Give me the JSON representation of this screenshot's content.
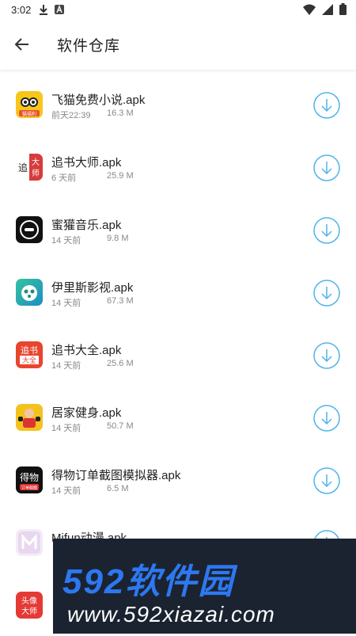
{
  "status": {
    "time": "3:02",
    "download_icon": "download-icon",
    "a_icon": "a-icon",
    "wifi_icon": "wifi-icon",
    "signal_icon": "signal-icon",
    "battery_icon": "battery-icon"
  },
  "header": {
    "title": "软件仓库",
    "back_icon": "arrow-back-icon"
  },
  "apps": [
    {
      "name": "飞猫免费小说.apk",
      "time": "前天22:39",
      "size": "16.3 M",
      "icon": "feimao-icon",
      "color": "#f7c61b"
    },
    {
      "name": "追书大师.apk",
      "time": "6 天前",
      "size": "25.9 M",
      "icon": "zhuishu-dashi-icon",
      "color": "#d83b3b"
    },
    {
      "name": "蜜獾音乐.apk",
      "time": "14 天前",
      "size": "9.8 M",
      "icon": "mihuan-music-icon",
      "color": "#111111"
    },
    {
      "name": "伊里斯影视.apk",
      "time": "14 天前",
      "size": "67.3 M",
      "icon": "yilisi-icon",
      "color": "#2bb38d"
    },
    {
      "name": "追书大全.apk",
      "time": "14 天前",
      "size": "25.6 M",
      "icon": "zhuishu-daquan-icon",
      "color": "#e8442e"
    },
    {
      "name": "居家健身.apk",
      "time": "14 天前",
      "size": "50.7 M",
      "icon": "jujia-fitness-icon",
      "color": "#f4c21f"
    },
    {
      "name": "得物订单截图模拟器.apk",
      "time": "14 天前",
      "size": "6.5 M",
      "icon": "dewu-icon",
      "color": "#111111"
    },
    {
      "name": "Mifun动漫.apk",
      "time": "",
      "size": "",
      "icon": "mifun-icon",
      "color": "#e9d7f0"
    },
    {
      "name": "",
      "time": "",
      "size": "",
      "icon": "touxiang-icon",
      "color": "#e53935"
    }
  ],
  "icon_texts": {
    "feimao": "猫福利",
    "zhuishu_dashi": [
      "大",
      "追",
      "师"
    ],
    "zhuishu_daquan": [
      "追书",
      "大全"
    ],
    "dewu": [
      "得物",
      "订单截图"
    ],
    "touxiang": [
      "头像",
      "大师"
    ]
  },
  "banner": {
    "title": "592软件园",
    "url": "www.592xiazai.com",
    "bg": "#1b2330",
    "accent": "#2d78f0"
  },
  "colors": {
    "download_ring": "#4fb4ea"
  }
}
